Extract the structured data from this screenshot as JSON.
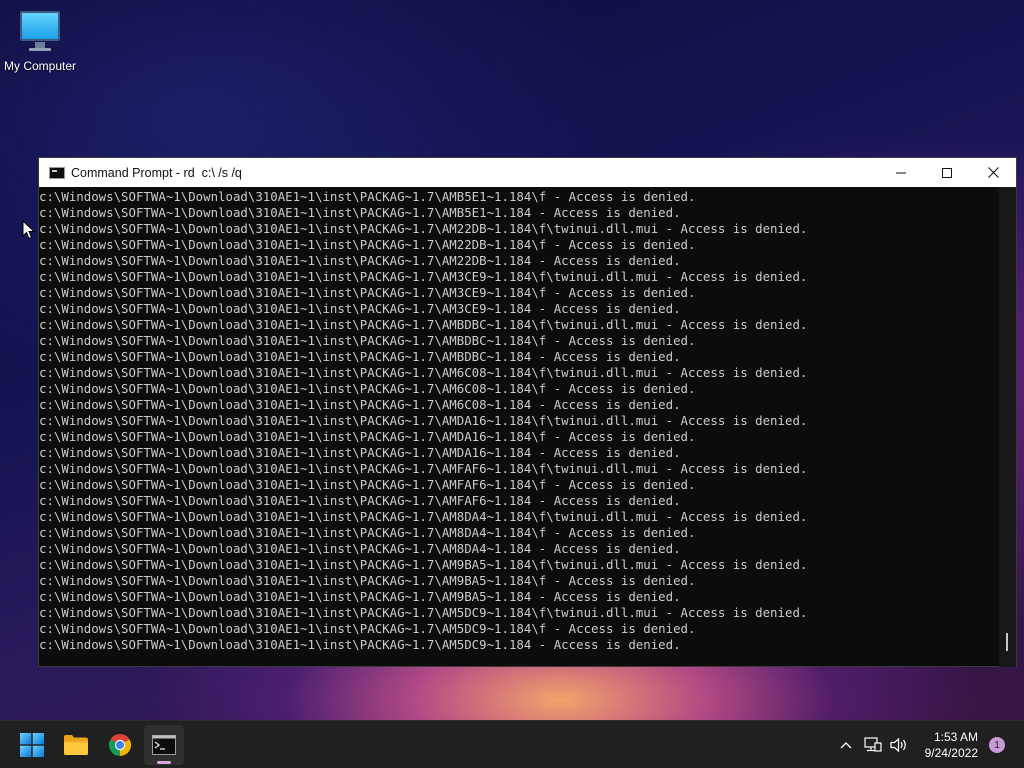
{
  "desktop": {
    "icons": [
      {
        "label": "My Computer",
        "icon": "monitor-icon"
      }
    ]
  },
  "window": {
    "title": "Command Prompt - rd  c:\\ /s /q",
    "icon": "console-icon",
    "controls": [
      "minimize-icon",
      "maximize-icon",
      "close-icon"
    ],
    "background": "#0c0c0c",
    "text_color": "#cccccc",
    "lines": [
      "c:\\Windows\\SOFTWA~1\\Download\\310AE1~1\\inst\\PACKAG~1.7\\AMB5E1~1.184\\f - Access is denied.",
      "c:\\Windows\\SOFTWA~1\\Download\\310AE1~1\\inst\\PACKAG~1.7\\AMB5E1~1.184 - Access is denied.",
      "c:\\Windows\\SOFTWA~1\\Download\\310AE1~1\\inst\\PACKAG~1.7\\AM22DB~1.184\\f\\twinui.dll.mui - Access is denied.",
      "c:\\Windows\\SOFTWA~1\\Download\\310AE1~1\\inst\\PACKAG~1.7\\AM22DB~1.184\\f - Access is denied.",
      "c:\\Windows\\SOFTWA~1\\Download\\310AE1~1\\inst\\PACKAG~1.7\\AM22DB~1.184 - Access is denied.",
      "c:\\Windows\\SOFTWA~1\\Download\\310AE1~1\\inst\\PACKAG~1.7\\AM3CE9~1.184\\f\\twinui.dll.mui - Access is denied.",
      "c:\\Windows\\SOFTWA~1\\Download\\310AE1~1\\inst\\PACKAG~1.7\\AM3CE9~1.184\\f - Access is denied.",
      "c:\\Windows\\SOFTWA~1\\Download\\310AE1~1\\inst\\PACKAG~1.7\\AM3CE9~1.184 - Access is denied.",
      "c:\\Windows\\SOFTWA~1\\Download\\310AE1~1\\inst\\PACKAG~1.7\\AMBDBC~1.184\\f\\twinui.dll.mui - Access is denied.",
      "c:\\Windows\\SOFTWA~1\\Download\\310AE1~1\\inst\\PACKAG~1.7\\AMBDBC~1.184\\f - Access is denied.",
      "c:\\Windows\\SOFTWA~1\\Download\\310AE1~1\\inst\\PACKAG~1.7\\AMBDBC~1.184 - Access is denied.",
      "c:\\Windows\\SOFTWA~1\\Download\\310AE1~1\\inst\\PACKAG~1.7\\AM6C08~1.184\\f\\twinui.dll.mui - Access is denied.",
      "c:\\Windows\\SOFTWA~1\\Download\\310AE1~1\\inst\\PACKAG~1.7\\AM6C08~1.184\\f - Access is denied.",
      "c:\\Windows\\SOFTWA~1\\Download\\310AE1~1\\inst\\PACKAG~1.7\\AM6C08~1.184 - Access is denied.",
      "c:\\Windows\\SOFTWA~1\\Download\\310AE1~1\\inst\\PACKAG~1.7\\AMDA16~1.184\\f\\twinui.dll.mui - Access is denied.",
      "c:\\Windows\\SOFTWA~1\\Download\\310AE1~1\\inst\\PACKAG~1.7\\AMDA16~1.184\\f - Access is denied.",
      "c:\\Windows\\SOFTWA~1\\Download\\310AE1~1\\inst\\PACKAG~1.7\\AMDA16~1.184 - Access is denied.",
      "c:\\Windows\\SOFTWA~1\\Download\\310AE1~1\\inst\\PACKAG~1.7\\AMFAF6~1.184\\f\\twinui.dll.mui - Access is denied.",
      "c:\\Windows\\SOFTWA~1\\Download\\310AE1~1\\inst\\PACKAG~1.7\\AMFAF6~1.184\\f - Access is denied.",
      "c:\\Windows\\SOFTWA~1\\Download\\310AE1~1\\inst\\PACKAG~1.7\\AMFAF6~1.184 - Access is denied.",
      "c:\\Windows\\SOFTWA~1\\Download\\310AE1~1\\inst\\PACKAG~1.7\\AM8DA4~1.184\\f\\twinui.dll.mui - Access is denied.",
      "c:\\Windows\\SOFTWA~1\\Download\\310AE1~1\\inst\\PACKAG~1.7\\AM8DA4~1.184\\f - Access is denied.",
      "c:\\Windows\\SOFTWA~1\\Download\\310AE1~1\\inst\\PACKAG~1.7\\AM8DA4~1.184 - Access is denied.",
      "c:\\Windows\\SOFTWA~1\\Download\\310AE1~1\\inst\\PACKAG~1.7\\AM9BA5~1.184\\f\\twinui.dll.mui - Access is denied.",
      "c:\\Windows\\SOFTWA~1\\Download\\310AE1~1\\inst\\PACKAG~1.7\\AM9BA5~1.184\\f - Access is denied.",
      "c:\\Windows\\SOFTWA~1\\Download\\310AE1~1\\inst\\PACKAG~1.7\\AM9BA5~1.184 - Access is denied.",
      "c:\\Windows\\SOFTWA~1\\Download\\310AE1~1\\inst\\PACKAG~1.7\\AM5DC9~1.184\\f\\twinui.dll.mui - Access is denied.",
      "c:\\Windows\\SOFTWA~1\\Download\\310AE1~1\\inst\\PACKAG~1.7\\AM5DC9~1.184\\f - Access is denied.",
      "c:\\Windows\\SOFTWA~1\\Download\\310AE1~1\\inst\\PACKAG~1.7\\AM5DC9~1.184 - Access is denied."
    ]
  },
  "taskbar": {
    "pinned": [
      {
        "icon": "windows-start-icon",
        "active": false
      },
      {
        "icon": "file-explorer-icon",
        "active": false
      },
      {
        "icon": "chrome-icon",
        "active": false
      },
      {
        "icon": "terminal-icon",
        "active": true
      }
    ],
    "tray_icons": [
      "chevron-up-icon",
      "network-icon",
      "volume-icon"
    ],
    "time": "1:53 AM",
    "date": "9/24/2022",
    "notification_count": "1",
    "accent_color": "#c99bd6"
  }
}
